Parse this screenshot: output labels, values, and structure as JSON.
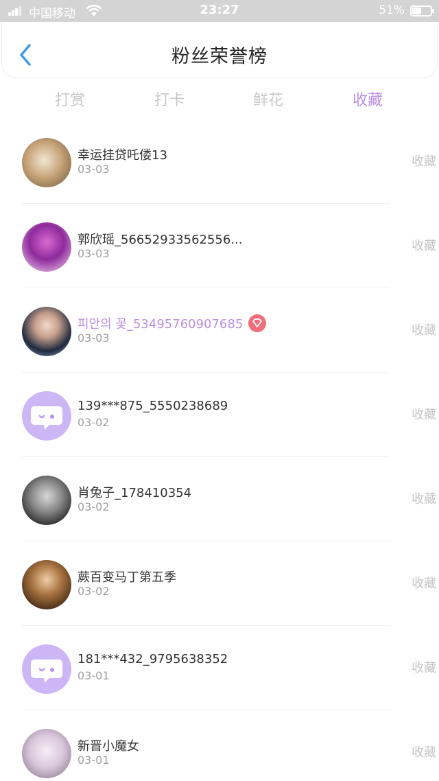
{
  "status_bar": {
    "carrier": "中国移动",
    "time": "23:27",
    "battery": "51%",
    "battery_level": 0.51
  },
  "nav": {
    "back_icon": "chevron-left-icon",
    "title": "粉丝荣誉榜"
  },
  "tabs": [
    {
      "label": "打赏",
      "active": false
    },
    {
      "label": "打卡",
      "active": false
    },
    {
      "label": "鲜花",
      "active": false
    },
    {
      "label": "收藏",
      "active": true
    }
  ],
  "colors": {
    "accent": "#b98fdf",
    "back_icon": "#3a9be8",
    "vip_badge": "#f06e7a",
    "default_avatar": "#cdb6f5"
  },
  "fans": [
    {
      "name": "幸运挂贷吒偻13",
      "date": "03-03",
      "action": "收藏",
      "avatar": "cat-photo",
      "vip": false
    },
    {
      "name": "郭欣瑶_56652933562556...",
      "date": "03-03",
      "action": "收藏",
      "avatar": "purple-tree-photo",
      "vip": false
    },
    {
      "name": "피안의 꽃_53495760907685",
      "date": "03-03",
      "action": "收藏",
      "avatar": "person-photo",
      "vip": true
    },
    {
      "name": "139***875_5550238689",
      "date": "03-02",
      "action": "收藏",
      "avatar": "default-chat-avatar",
      "vip": false
    },
    {
      "name": "肖兔子_178410354",
      "date": "03-02",
      "action": "收藏",
      "avatar": "person-photo-bw",
      "vip": false
    },
    {
      "name": "蕨百变马丁第五季",
      "date": "03-02",
      "action": "收藏",
      "avatar": "person-photo-warm",
      "vip": false
    },
    {
      "name": "181***432_9795638352",
      "date": "03-01",
      "action": "收藏",
      "avatar": "default-chat-avatar",
      "vip": false
    },
    {
      "name": "新晋小魔女",
      "date": "03-01",
      "action": "收藏",
      "avatar": "anime-photo",
      "vip": false
    }
  ]
}
